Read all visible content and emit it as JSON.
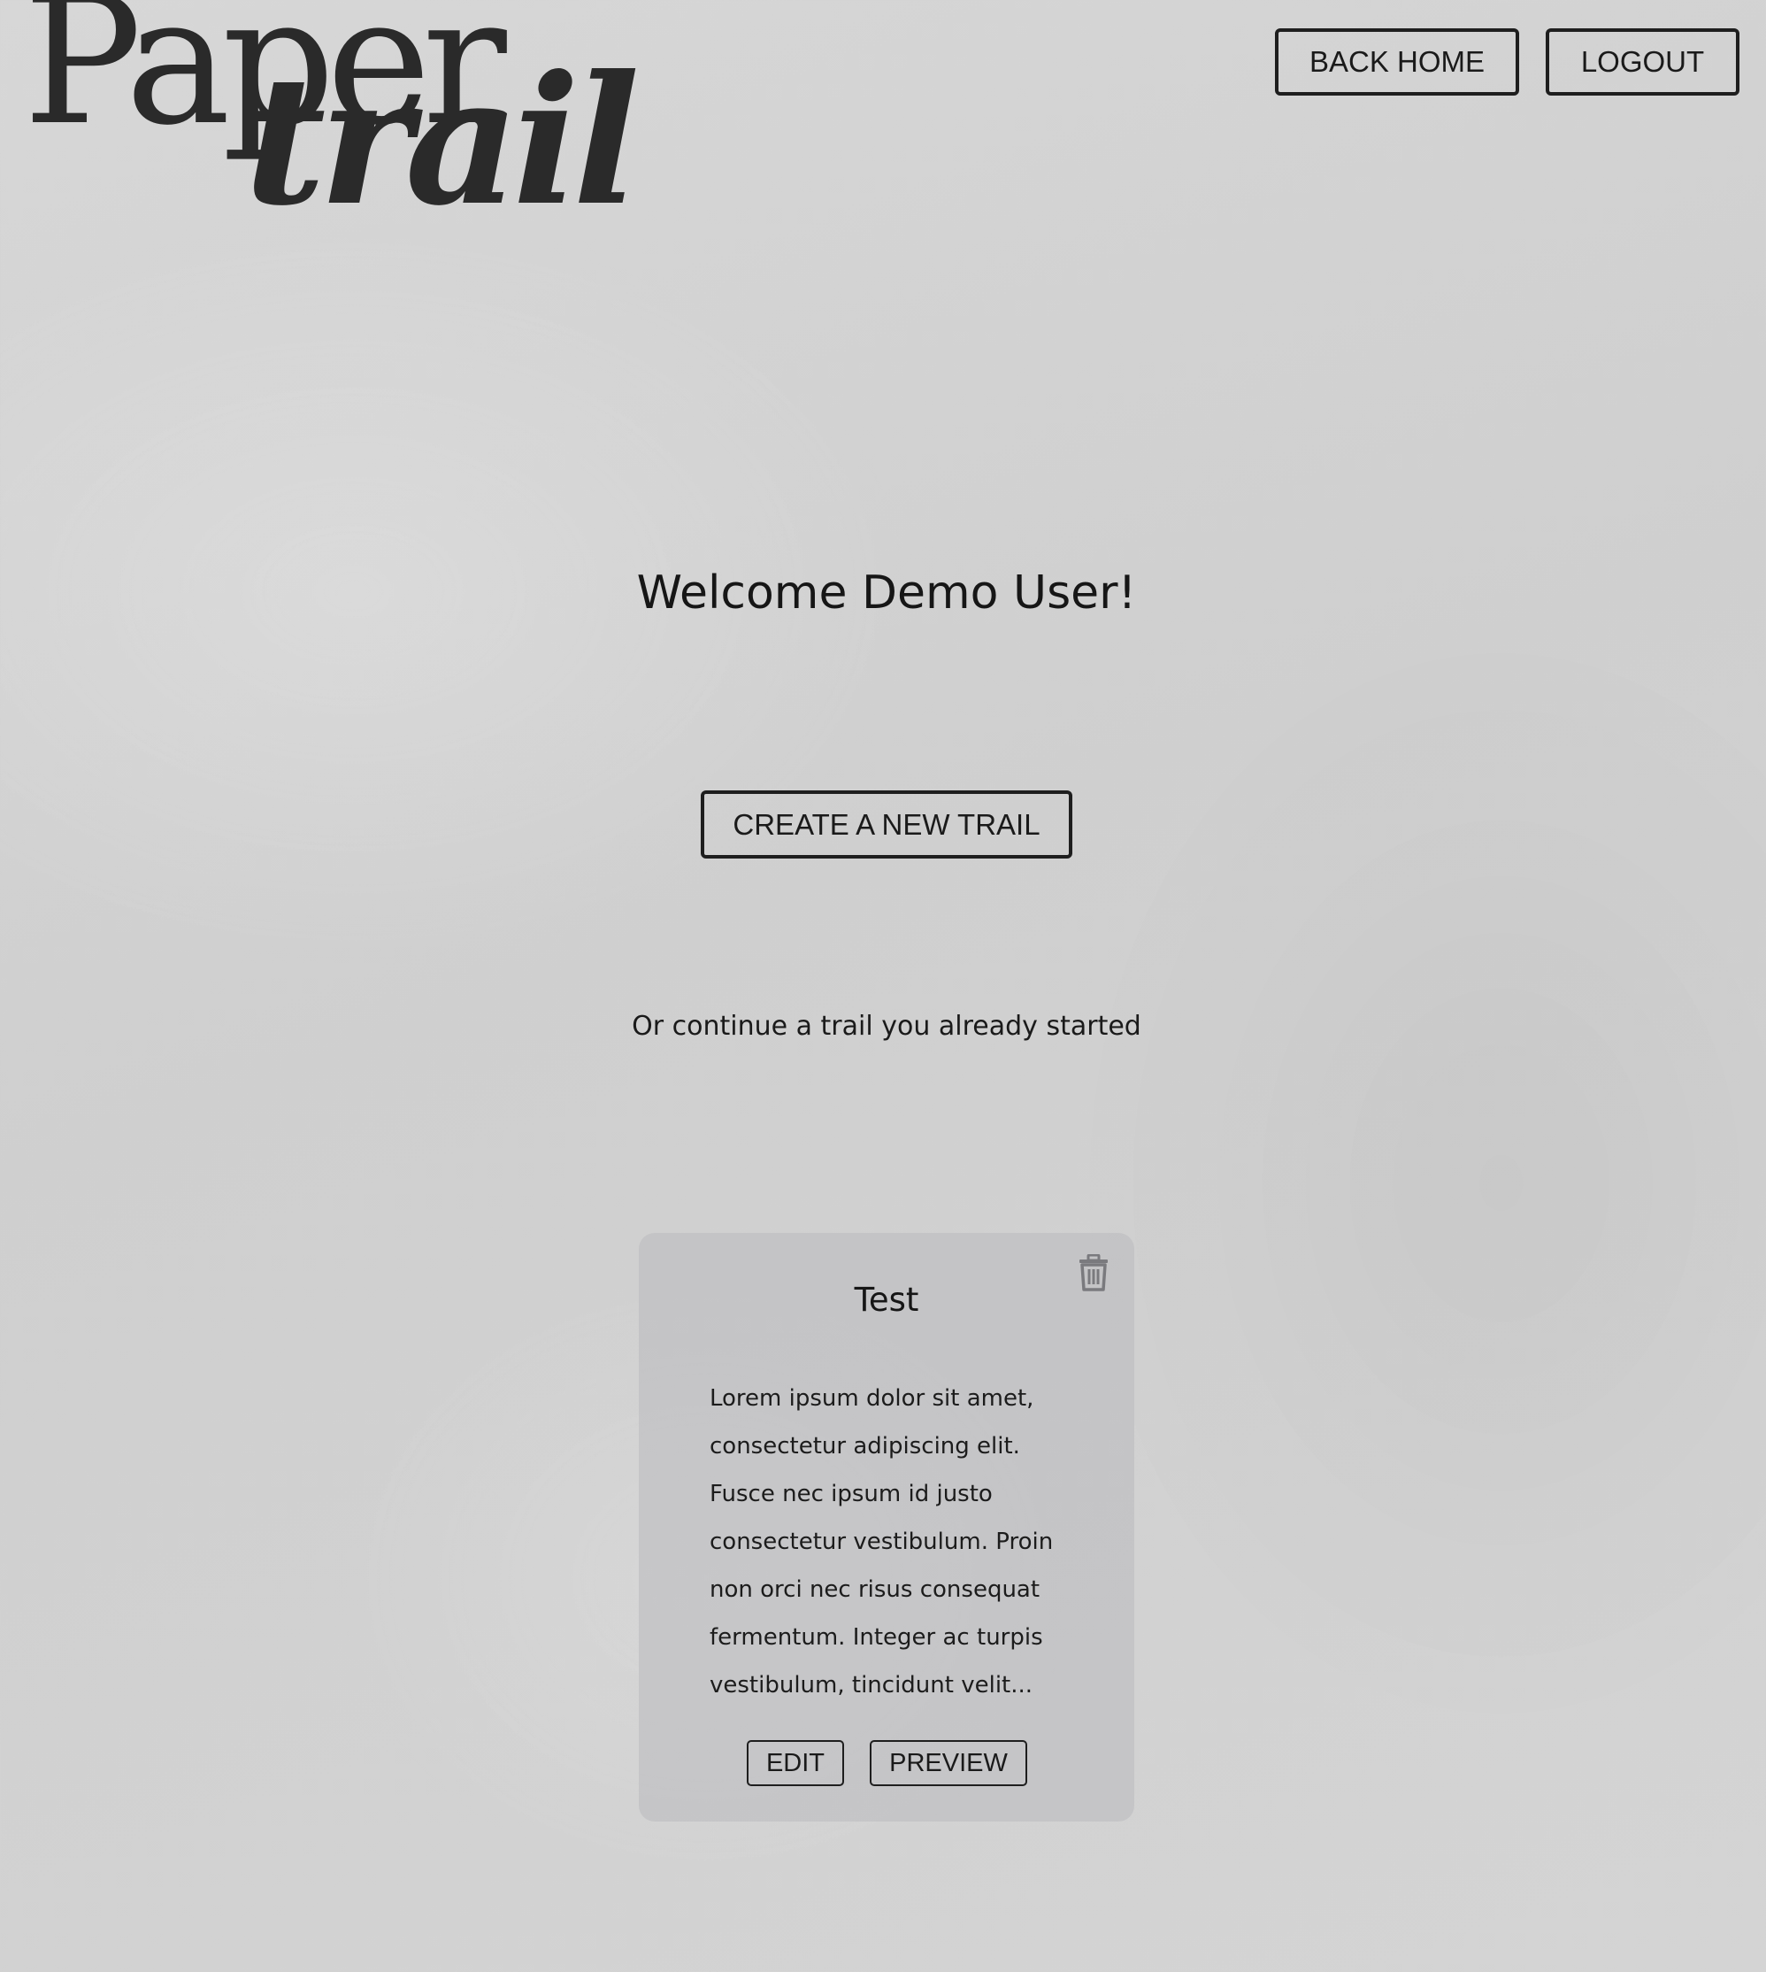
{
  "logo": {
    "line1": "Paper",
    "line2": "trail"
  },
  "header": {
    "back_home_label": "BACK HOME",
    "logout_label": "LOGOUT"
  },
  "main": {
    "welcome": "Welcome Demo User!",
    "create_label": "CREATE A NEW TRAIL",
    "continue_text": "Or continue a trail you already started"
  },
  "trails": [
    {
      "title": "Test",
      "description": "Lorem ipsum dolor sit amet, consectetur adipiscing elit. Fusce nec ipsum id justo consectetur vestibulum. Proin non orci nec risus consequat fermentum. Integer ac turpis vestibulum, tincidunt velit...",
      "edit_label": "EDIT",
      "preview_label": "PREVIEW",
      "delete_icon": "trash-icon"
    }
  ]
}
